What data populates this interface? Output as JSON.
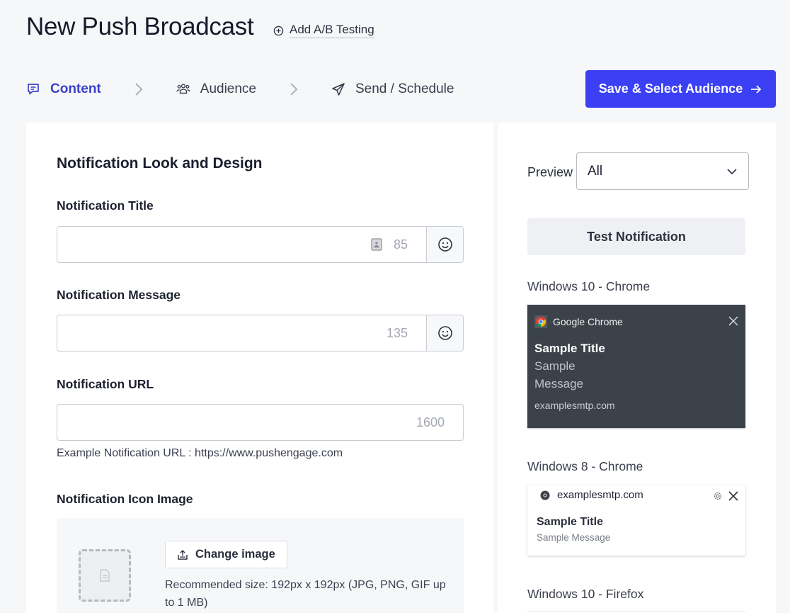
{
  "header": {
    "title": "New Push Broadcast",
    "ab_testing_label": "Add A/B Testing"
  },
  "steps": [
    {
      "label": "Content",
      "icon": "message-icon",
      "active": true
    },
    {
      "label": "Audience",
      "icon": "users-icon",
      "active": false
    },
    {
      "label": "Send / Schedule",
      "icon": "send-icon",
      "active": false
    }
  ],
  "primary_action": {
    "label": "Save & Select Audience",
    "icon": "arrow-right-icon",
    "color": "#3b40f5"
  },
  "form": {
    "section_title": "Notification Look and Design",
    "title_field": {
      "label": "Notification Title",
      "value": "",
      "placeholder": "",
      "remaining": "85"
    },
    "message_field": {
      "label": "Notification Message",
      "value": "",
      "placeholder": "",
      "remaining": "135"
    },
    "url_field": {
      "label": "Notification URL",
      "value": "",
      "placeholder": "",
      "remaining": "1600",
      "help": "Example Notification URL : https://www.pushengage.com"
    },
    "icon_image": {
      "label": "Notification Icon Image",
      "change_button": "Change image",
      "recommendation": "Recommended size: 192px x 192px (JPG, PNG, GIF up to 1 MB)"
    }
  },
  "preview": {
    "label": "Preview",
    "selected": "All",
    "test_button": "Test Notification",
    "win10_chrome": {
      "os_label": "Windows 10 - Chrome",
      "browser": "Google Chrome",
      "title": "Sample Title",
      "message": "Sample Message",
      "domain": "examplesmtp.com"
    },
    "win8_chrome": {
      "os_label": "Windows 8 - Chrome",
      "domain": "examplesmtp.com",
      "title": "Sample Title",
      "message": "Sample Message"
    },
    "win10_firefox": {
      "os_label": "Windows 10 - Firefox"
    }
  }
}
